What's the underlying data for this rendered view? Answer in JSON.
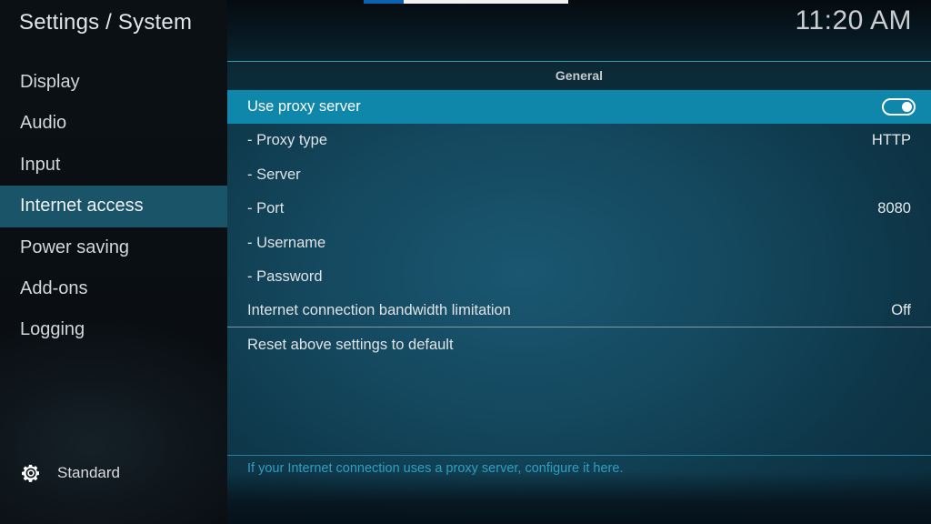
{
  "window": {
    "title": "Settings / System",
    "clock": "11:20 AM"
  },
  "loading_bar": {
    "visible": true,
    "accent_color": "#0a62b0",
    "track_color": "#f2f2f2"
  },
  "sidebar": {
    "items": [
      {
        "label": "Display",
        "selected": false
      },
      {
        "label": "Audio",
        "selected": false
      },
      {
        "label": "Input",
        "selected": false
      },
      {
        "label": "Internet access",
        "selected": true
      },
      {
        "label": "Power saving",
        "selected": false
      },
      {
        "label": "Add-ons",
        "selected": false
      },
      {
        "label": "Logging",
        "selected": false
      }
    ],
    "profile": {
      "icon": "gear-icon",
      "label": "Standard"
    }
  },
  "main": {
    "group_header": "General",
    "rows": [
      {
        "label": "Use proxy server",
        "value": "",
        "control": "toggle",
        "toggle_on": true,
        "highlight": true
      },
      {
        "label": "- Proxy type",
        "value": "HTTP",
        "control": "value",
        "highlight": false
      },
      {
        "label": "- Server",
        "value": "",
        "control": "value",
        "highlight": false
      },
      {
        "label": "- Port",
        "value": "8080",
        "control": "value",
        "highlight": false
      },
      {
        "label": "- Username",
        "value": "",
        "control": "value",
        "highlight": false
      },
      {
        "label": "- Password",
        "value": "",
        "control": "value",
        "highlight": false
      },
      {
        "label": "Internet connection bandwidth limitation",
        "value": "Off",
        "control": "value",
        "highlight": false
      },
      {
        "label": "Reset above settings to default",
        "value": "",
        "control": "value",
        "highlight": false
      }
    ],
    "divider_after_index": 6,
    "hint": "If your Internet connection uses a proxy server, configure it here."
  },
  "colors": {
    "highlight": "#0f87aa",
    "sidebar_selected": "#1a5468",
    "hint_text": "#2f9fc0",
    "panel_rule": "#3fa8c4"
  }
}
